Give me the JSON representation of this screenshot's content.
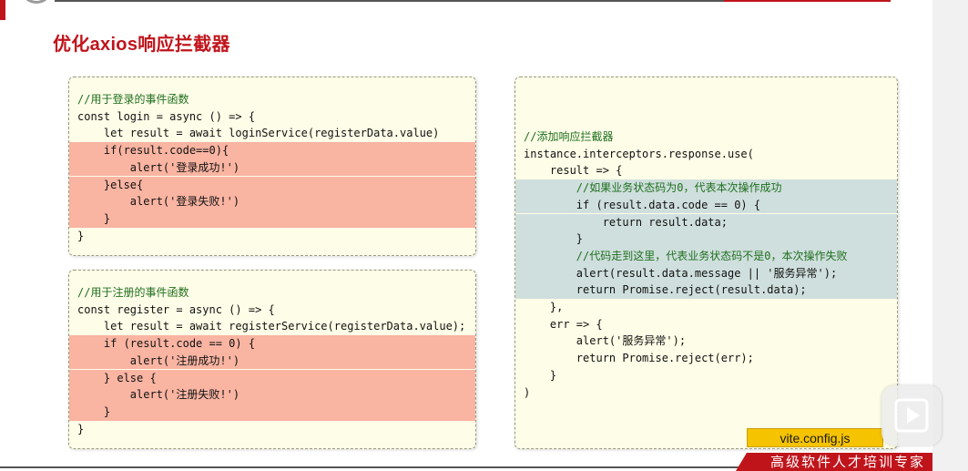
{
  "slide": {
    "title": "优化axios响应拦截器",
    "file_tag": "vite.config.js",
    "footer_text": "高级软件人才培训专家"
  },
  "colors": {
    "brand_red": "#c0141b",
    "code_bg": "#fefde7",
    "highlight_red": "#f9b4a2",
    "highlight_teal": "#cfdfdd",
    "tag_yellow": "#f5c300"
  },
  "login_box": {
    "lines": [
      "//用于登录的事件函数",
      "const login = async () => {",
      "    let result = await loginService(registerData.value)",
      "    if(result.code==0){",
      "        alert('登录成功!')",
      "    }else{",
      "        alert('登录失败!')",
      "    }",
      "}"
    ]
  },
  "register_box": {
    "lines": [
      "//用于注册的事件函数",
      "const register = async () => {",
      "    let result = await registerService(registerData.value);",
      "    if (result.code == 0) {",
      "        alert('注册成功!')",
      "    } else {",
      "        alert('注册失败!')",
      "    }",
      "}"
    ]
  },
  "interceptor_box": {
    "lines": [
      "//添加响应拦截器",
      "instance.interceptors.response.use(",
      "    result => {",
      "        //如果业务状态码为0，代表本次操作成功",
      "        if (result.data.code == 0) {",
      "            return result.data;",
      "        }",
      "        //代码走到这里，代表业务状态码不是0，本次操作失败",
      "        alert(result.data.message || '服务异常');",
      "        return Promise.reject(result.data);",
      "    },",
      "    err => {",
      "        alert('服务异常');",
      "        return Promise.reject(err);",
      "    }",
      ")"
    ]
  },
  "controls": {
    "play_icon": "play-icon"
  }
}
